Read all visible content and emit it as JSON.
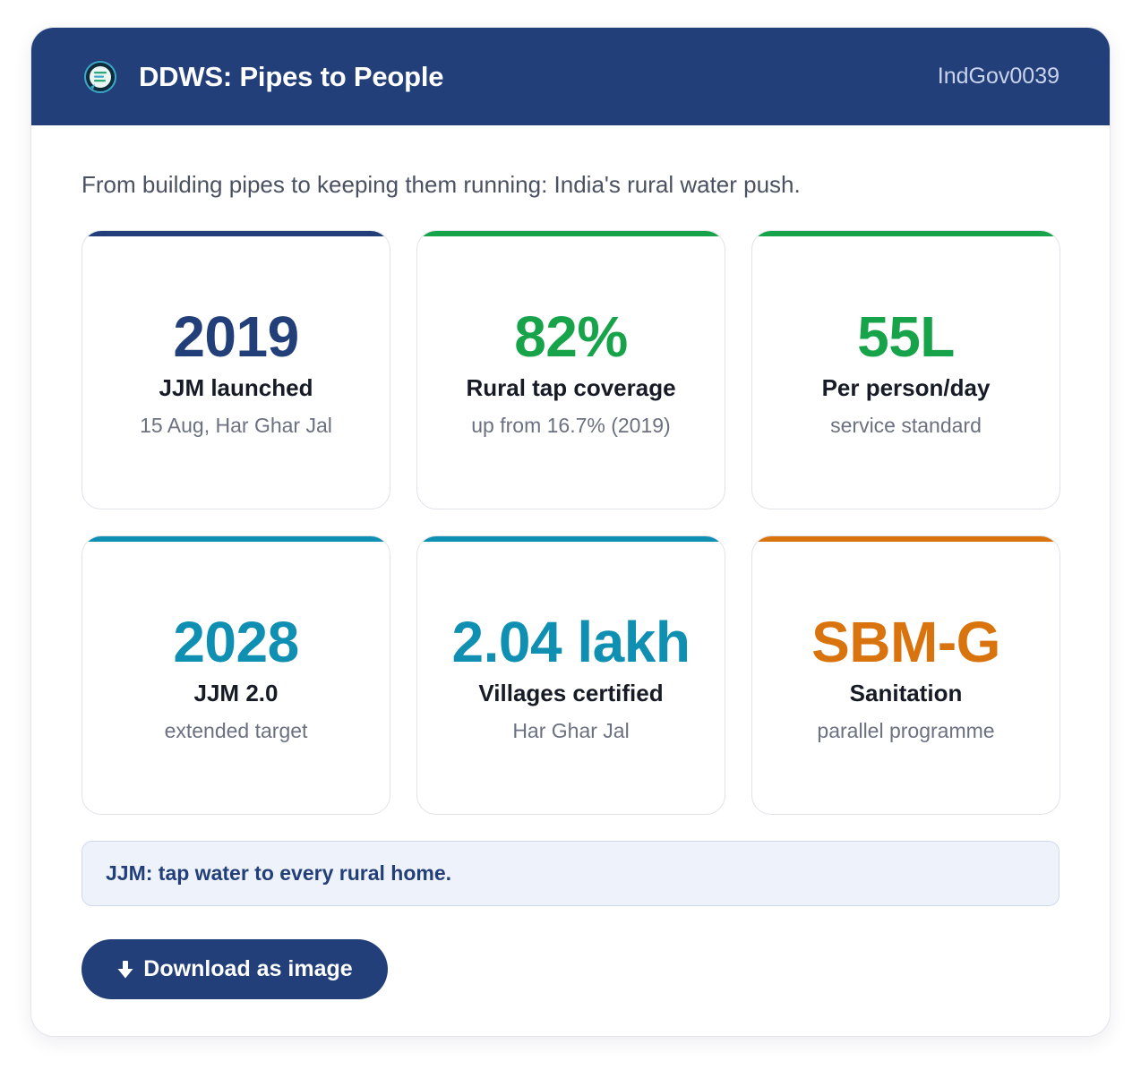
{
  "header": {
    "title": "DDWS: Pipes to People",
    "code": "IndGov0039"
  },
  "subtitle": "From building pipes to keeping them running: India's rural water push.",
  "stats": [
    {
      "value": "2019",
      "label": "JJM launched",
      "note": "15 Aug, Har Ghar Jal",
      "color": "#233f7a"
    },
    {
      "value": "82%",
      "label": "Rural tap coverage",
      "note": "up from 16.7% (2019)",
      "color": "#17a34a"
    },
    {
      "value": "55L",
      "label": "Per person/day",
      "note": "service standard",
      "color": "#17a34a"
    },
    {
      "value": "2028",
      "label": "JJM 2.0",
      "note": "extended target",
      "color": "#0f8fb2"
    },
    {
      "value": "2.04 lakh",
      "label": "Villages certified",
      "note": "Har Ghar Jal",
      "color": "#0f8fb2"
    },
    {
      "value": "SBM-G",
      "label": "Sanitation",
      "note": "parallel programme",
      "color": "#d9730d"
    }
  ],
  "callout": "JJM: tap water to every rural home.",
  "download_label": "Download as image",
  "icons": {
    "logo": "chat-logo-icon",
    "download": "download-arrow-icon"
  }
}
